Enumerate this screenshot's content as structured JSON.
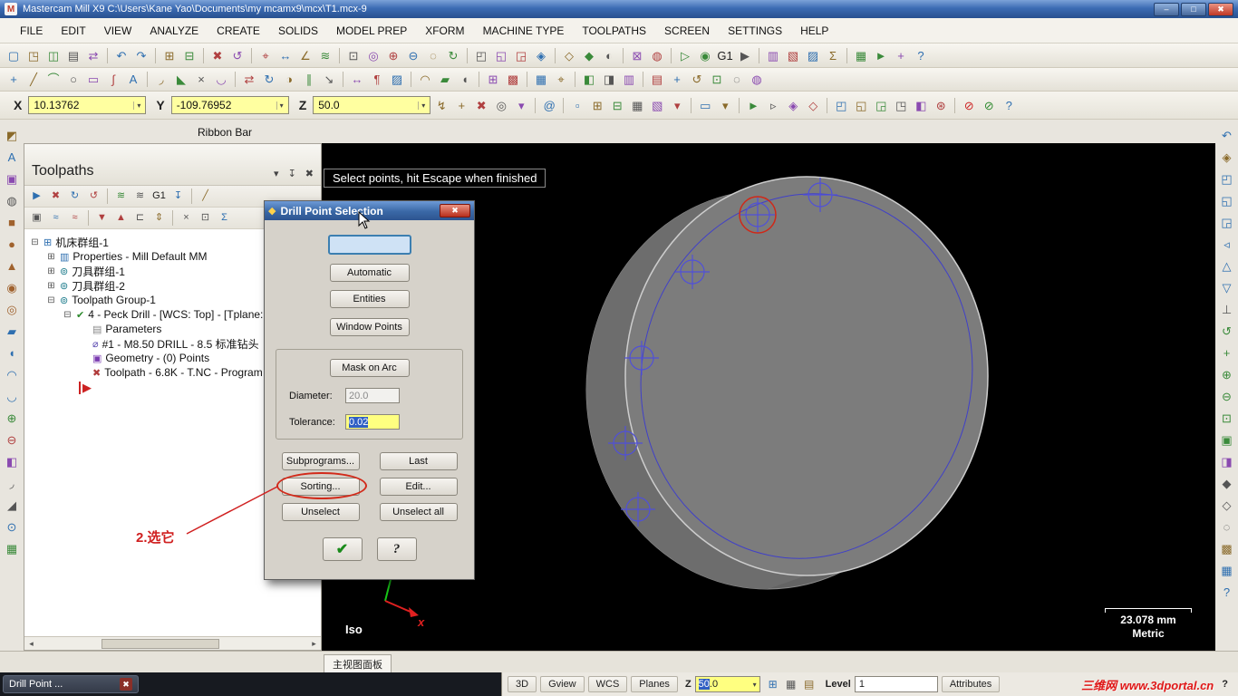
{
  "glyphs": {
    "dropdown": "▾",
    "scroll_left": "◂",
    "scroll_right": "▸"
  },
  "colors": {
    "field_yellow": "#ffff80",
    "selection_blue": "#2f5fc4",
    "annotation_red": "#d02020",
    "drill_blue": "#4848d0",
    "viewport_bg": "#000000"
  },
  "titlebar": {
    "app_icon": "M",
    "title": "Mastercam Mill X9  C:\\Users\\Kane Yao\\Documents\\my mcamx9\\mcx\\T1.mcx-9",
    "minimize": "–",
    "maximize": "□",
    "close": "✖"
  },
  "menu": {
    "items": [
      {
        "n": "menu-file",
        "label": "FILE"
      },
      {
        "n": "menu-edit",
        "label": "EDIT"
      },
      {
        "n": "menu-view",
        "label": "VIEW"
      },
      {
        "n": "menu-analyze",
        "label": "ANALYZE"
      },
      {
        "n": "menu-create",
        "label": "CREATE"
      },
      {
        "n": "menu-solids",
        "label": "SOLIDS"
      },
      {
        "n": "menu-model-prep",
        "label": "MODEL PREP"
      },
      {
        "n": "menu-xform",
        "label": "XFORM"
      },
      {
        "n": "menu-machine-type",
        "label": "MACHINE TYPE"
      },
      {
        "n": "menu-toolpaths",
        "label": "TOOLPATHS"
      },
      {
        "n": "menu-screen",
        "label": "SCREEN"
      },
      {
        "n": "menu-settings",
        "label": "SETTINGS"
      },
      {
        "n": "menu-help",
        "label": "HELP"
      }
    ]
  },
  "toolbars": {
    "row1": [
      {
        "n": "new-file-icon",
        "g": "▢"
      },
      {
        "n": "open-file-icon",
        "g": "◳"
      },
      {
        "n": "save-file-icon",
        "g": "◫"
      },
      {
        "n": "print-icon",
        "g": "▤"
      },
      {
        "n": "file-converters-icon",
        "g": "⇄"
      },
      "|",
      {
        "n": "undo-icon",
        "g": "↶",
        "c": "#2e6fb0"
      },
      {
        "n": "redo-icon",
        "g": "↷",
        "c": "#2e6fb0"
      },
      "|",
      {
        "n": "copy-screen-image-icon",
        "g": "⊞"
      },
      {
        "n": "paste-image-icon",
        "g": "⊟"
      },
      "|",
      {
        "n": "delete-entities-icon",
        "g": "✖",
        "c": "#b04040"
      },
      {
        "n": "undelete-icon",
        "g": "↺"
      },
      "|",
      {
        "n": "analyze-position-icon",
        "g": "⌖"
      },
      {
        "n": "analyze-distance-icon",
        "g": "↔"
      },
      {
        "n": "analyze-angle-icon",
        "g": "∠"
      },
      {
        "n": "analyze-dynamic-icon",
        "g": "≋"
      },
      "|",
      {
        "n": "zoom-window-icon",
        "g": "⊡"
      },
      {
        "n": "zoom-target-icon",
        "g": "◎"
      },
      {
        "n": "zoom-in-icon",
        "g": "⊕"
      },
      {
        "n": "zoom-out-icon",
        "g": "⊖"
      },
      {
        "n": "unzoom-icon",
        "g": "◌"
      },
      {
        "n": "repaint-icon",
        "g": "↻"
      },
      "|",
      {
        "n": "gview-top-icon",
        "g": "◰"
      },
      {
        "n": "gview-front-icon",
        "g": "◱"
      },
      {
        "n": "gview-right-icon",
        "g": "◲"
      },
      {
        "n": "gview-iso-icon",
        "g": "◈"
      },
      "|",
      {
        "n": "wireframe-display-icon",
        "g": "◇"
      },
      {
        "n": "shaded-display-icon",
        "g": "◆"
      },
      {
        "n": "translucent-display-icon",
        "g": "◐"
      },
      "|",
      {
        "n": "delete-duplicates-icon",
        "g": "⊠"
      },
      {
        "n": "blank-entity-icon",
        "g": "◍"
      },
      "|",
      {
        "n": "backplot-icon",
        "g": "▷",
        "c": "#3a8a3a"
      },
      {
        "n": "verify-icon",
        "g": "◉",
        "c": "#3a8a3a"
      },
      {
        "n": "post-process-icon",
        "g": "G1",
        "c": "#222"
      },
      {
        "n": "machine-sim-icon",
        "g": "▶"
      },
      "|",
      {
        "n": "toolpath-manager-toggle-icon",
        "g": "▥"
      },
      {
        "n": "solids-manager-toggle-icon",
        "g": "▧"
      },
      {
        "n": "art-manager-icon",
        "g": "▨"
      },
      {
        "n": "multithread-manager-icon",
        "g": "Σ"
      },
      "|",
      {
        "n": "grid-settings-icon",
        "g": "▦"
      },
      {
        "n": "run-user-app-icon",
        "g": "►",
        "c": "#3a8a3a"
      },
      {
        "n": "configure-icon",
        "g": "+"
      },
      {
        "n": "help-context-icon",
        "g": "?",
        "c": "#2e6fb0"
      }
    ],
    "row2": [
      {
        "n": "create-point-icon",
        "g": "+"
      },
      {
        "n": "create-line-icon",
        "g": "╱"
      },
      {
        "n": "create-arc-icon",
        "g": "⌒"
      },
      {
        "n": "create-circle-icon",
        "g": "○"
      },
      {
        "n": "create-rectangle-icon",
        "g": "▭"
      },
      {
        "n": "create-spline-icon",
        "g": "∫"
      },
      {
        "n": "create-letters-icon",
        "g": "A"
      },
      "|",
      {
        "n": "fillet-entities-icon",
        "g": "◞"
      },
      {
        "n": "chamfer-entities-icon",
        "g": "◣"
      },
      {
        "n": "trim-break-icon",
        "g": "×"
      },
      {
        "n": "join-entities-icon",
        "g": "◡"
      },
      "|",
      {
        "n": "xform-translate-icon",
        "g": "⇄"
      },
      {
        "n": "xform-rotate-icon",
        "g": "↻"
      },
      {
        "n": "xform-mirror-icon",
        "g": "◑"
      },
      {
        "n": "xform-offset-icon",
        "g": "∥"
      },
      {
        "n": "xform-scale-icon",
        "g": "↘"
      },
      "|",
      {
        "n": "drafting-dimension-icon",
        "g": "↔"
      },
      {
        "n": "drafting-note-icon",
        "g": "¶"
      },
      {
        "n": "crosshatch-icon",
        "g": "▨"
      },
      "|",
      {
        "n": "surface-net-icon",
        "g": "◠"
      },
      {
        "n": "solid-extrude-icon",
        "g": "▰"
      },
      {
        "n": "solid-revolve-icon",
        "g": "◖"
      },
      "|",
      {
        "n": "machine-group-properties-icon",
        "g": "⊞"
      },
      {
        "n": "material-setup-icon",
        "g": "▩"
      },
      "|",
      {
        "n": "grid-toggle-icon",
        "g": "▦"
      },
      {
        "n": "snap-settings-icon",
        "g": "⌖"
      },
      "|",
      {
        "n": "view-manager-icon",
        "g": "◧"
      },
      {
        "n": "plane-manager-icon",
        "g": "◨"
      },
      {
        "n": "level-manager-icon",
        "g": "▥"
      },
      "|",
      {
        "n": "group-manager-icon",
        "g": "▤"
      },
      {
        "n": "pan-icon",
        "g": "+"
      },
      {
        "n": "dynamic-rotate-icon",
        "g": "↺"
      },
      {
        "n": "zoom-fit-icon",
        "g": "⊡"
      },
      {
        "n": "hide-entities-icon",
        "g": "◌"
      },
      {
        "n": "isolate-icon",
        "g": "◍"
      }
    ]
  },
  "coord_bar": {
    "x_label": "X",
    "x_value": "10.13762",
    "y_label": "Y",
    "y_value": "-109.76952",
    "z_label": "Z",
    "z_value": "50.0",
    "icons": [
      {
        "n": "autocursor-override-icon",
        "g": "↯",
        "c": "#8a6a2a"
      },
      {
        "n": "autocursor-config-icon",
        "g": "+"
      },
      {
        "n": "clear-coord-icon",
        "g": "✖",
        "c": "#b04040"
      },
      {
        "n": "fastpoint-mode-icon",
        "g": "◎"
      },
      {
        "n": "autocursor-dropdown-icon",
        "g": "▾"
      },
      "|",
      {
        "n": "coord-help-icon",
        "g": "@",
        "c": "#2e6fb0"
      },
      "|",
      {
        "n": "select-window-icon",
        "g": "▫"
      },
      {
        "n": "select-polygon-icon",
        "g": "⊞"
      },
      {
        "n": "select-single-icon",
        "g": "⊟"
      },
      {
        "n": "select-area-icon",
        "g": "▦"
      },
      {
        "n": "select-vector-icon",
        "g": "▧"
      },
      {
        "n": "selection-dropdown-icon",
        "g": "▾"
      },
      "|",
      {
        "n": "select-all-icon",
        "g": "▭"
      },
      {
        "n": "select-only-dropdown-icon",
        "g": "▾"
      },
      "|",
      {
        "n": "select-last-icon",
        "g": "►"
      },
      {
        "n": "select-result-icon",
        "g": "▹"
      },
      {
        "n": "select-solids-mode-icon",
        "g": "◈"
      },
      {
        "n": "select-wireframe-mode-icon",
        "g": "◇"
      },
      "|",
      {
        "n": "gview-wcs-icon",
        "g": "◰"
      },
      {
        "n": "gview-cplane-icon",
        "g": "◱"
      },
      {
        "n": "gview-tplane-icon",
        "g": "◲"
      },
      {
        "n": "gview-iso-small-icon",
        "g": "◳"
      },
      {
        "n": "wcs-indicator-icon",
        "g": "◧"
      },
      {
        "n": "plane-follow-icon",
        "g": "⊛"
      },
      "|",
      {
        "n": "gview-lock-icon",
        "g": "⊘",
        "c": "#cc2222"
      },
      {
        "n": "plane-lock-icon",
        "g": "⊘",
        "c": "#2e8a2e"
      },
      {
        "n": "autocursor-help-icon",
        "g": "?",
        "c": "#2e6fb0"
      }
    ]
  },
  "ribbon_bar_label": "Ribbon Bar",
  "left_toolbar": [
    {
      "n": "raster-to-vector-icon",
      "g": "◩",
      "c": "#8a6a2a"
    },
    {
      "n": "create-letters-left-icon",
      "g": "A",
      "c": "#2e6fb0"
    },
    {
      "n": "bounding-box-icon",
      "g": "▣",
      "c": "#8a4ab0"
    },
    {
      "n": "silhouette-boundary-icon",
      "g": "◍",
      "c": "#555"
    },
    {
      "n": "solid-box-icon",
      "g": "■",
      "c": "#a0622e"
    },
    {
      "n": "solid-cylinder-icon",
      "g": "●",
      "c": "#a0622e"
    },
    {
      "n": "solid-cone-icon",
      "g": "▲",
      "c": "#a0622e"
    },
    {
      "n": "solid-sphere-icon",
      "g": "◉",
      "c": "#a0622e"
    },
    {
      "n": "solid-torus-icon",
      "g": "◎",
      "c": "#a0622e"
    },
    {
      "n": "solid-extrude-left-icon",
      "g": "▰",
      "c": "#2e6fb0"
    },
    {
      "n": "solid-revolve-left-icon",
      "g": "◖",
      "c": "#2e6fb0"
    },
    {
      "n": "solid-sweep-icon",
      "g": "◠",
      "c": "#2e6fb0"
    },
    {
      "n": "solid-loft-icon",
      "g": "◡",
      "c": "#2e6fb0"
    },
    {
      "n": "boolean-add-icon",
      "g": "⊕",
      "c": "#3a8a3a"
    },
    {
      "n": "boolean-remove-icon",
      "g": "⊖",
      "c": "#b04040"
    },
    {
      "n": "solid-shell-icon",
      "g": "◧",
      "c": "#8a4ab0"
    },
    {
      "n": "solid-fillet-icon",
      "g": "◞",
      "c": "#555"
    },
    {
      "n": "solid-chamfer-icon",
      "g": "◢",
      "c": "#555"
    },
    {
      "n": "solid-hole-icon",
      "g": "⊙",
      "c": "#2e6fb0"
    },
    {
      "n": "solid-pattern-icon",
      "g": "▦",
      "c": "#3a8a3a"
    }
  ],
  "right_toolbar": [
    {
      "n": "view-previous-icon",
      "g": "↶",
      "c": "#2e6fb0"
    },
    {
      "n": "view-iso-icon",
      "g": "◈",
      "c": "#8a6a2a"
    },
    {
      "n": "view-top-icon",
      "g": "◰",
      "c": "#2e6fb0"
    },
    {
      "n": "view-front-icon",
      "g": "◱",
      "c": "#2e6fb0"
    },
    {
      "n": "view-right-icon",
      "g": "◲",
      "c": "#2e6fb0"
    },
    {
      "n": "view-left-icon",
      "g": "◃",
      "c": "#2e6fb0"
    },
    {
      "n": "view-back-icon",
      "g": "△",
      "c": "#2e6fb0"
    },
    {
      "n": "view-bottom-icon",
      "g": "▽",
      "c": "#2e6fb0"
    },
    {
      "n": "view-normal-icon",
      "g": "⊥",
      "c": "#555"
    },
    {
      "n": "rotate-view-icon",
      "g": "↺",
      "c": "#3a8a3a"
    },
    {
      "n": "pan-view-icon",
      "g": "+",
      "c": "#3a8a3a"
    },
    {
      "n": "zoom-in-right-icon",
      "g": "⊕",
      "c": "#3a8a3a"
    },
    {
      "n": "zoom-out-right-icon",
      "g": "⊖",
      "c": "#3a8a3a"
    },
    {
      "n": "zoom-window-right-icon",
      "g": "⊡",
      "c": "#3a8a3a"
    },
    {
      "n": "fit-view-icon",
      "g": "▣",
      "c": "#3a8a3a"
    },
    {
      "n": "section-view-icon",
      "g": "◨",
      "c": "#8a4ab0"
    },
    {
      "n": "shade-toggle-icon",
      "g": "◆",
      "c": "#555"
    },
    {
      "n": "wireframe-toggle-icon",
      "g": "◇",
      "c": "#555"
    },
    {
      "n": "blank-toggle-icon",
      "g": "◌",
      "c": "#555"
    },
    {
      "n": "material-render-icon",
      "g": "▩",
      "c": "#8a6a2a"
    },
    {
      "n": "viewport-settings-icon",
      "g": "▦",
      "c": "#2e6fb0"
    },
    {
      "n": "viewsheet-help-icon",
      "g": "?",
      "c": "#2e6fb0"
    }
  ],
  "toolpaths_panel": {
    "title": "Toolpaths",
    "dropdown_glyph": "▾",
    "pin_glyph": "↧",
    "close_glyph": "✖",
    "toolbar_row1": [
      {
        "n": "tp-select-all-icon",
        "g": "▶",
        "c": "#2e6fb0"
      },
      {
        "n": "tp-select-none-icon",
        "g": "✖",
        "c": "#b04040"
      },
      {
        "n": "tp-regen-all-icon",
        "g": "↻",
        "c": "#2e6fb0"
      },
      {
        "n": "tp-regen-selected-icon",
        "g": "↺",
        "c": "#b04040"
      },
      "|",
      {
        "n": "tp-filter-a-icon",
        "g": "≋",
        "c": "#3a8a3a"
      },
      {
        "n": "tp-filter-b-icon",
        "g": "≋",
        "c": "#555"
      },
      {
        "n": "tp-g1-icon",
        "g": "G1",
        "c": "#222"
      },
      {
        "n": "tp-send-icon",
        "g": "↧",
        "c": "#2e6fb0"
      },
      "|",
      {
        "n": "tp-simulate-icon",
        "g": "╱",
        "c": "#8a6a2a"
      }
    ],
    "toolbar_row2": [
      {
        "n": "tp-lock-icon",
        "g": "▣",
        "c": "#555"
      },
      {
        "n": "tp-toggle-display-icon",
        "g": "≈",
        "c": "#2e6fb0"
      },
      {
        "n": "tp-toggle-rapid-icon",
        "g": "≈",
        "c": "#b04040"
      },
      "|",
      {
        "n": "tp-move-down-icon",
        "g": "▼",
        "c": "#b04040"
      },
      {
        "n": "tp-move-up-icon",
        "g": "▲",
        "c": "#b04040"
      },
      {
        "n": "tp-insert-icon",
        "g": "⊏",
        "c": "#555"
      },
      {
        "n": "tp-scroll-icon",
        "g": "⇕",
        "c": "#8a6a2a"
      },
      "|",
      {
        "n": "tp-cut-icon",
        "g": "×",
        "c": "#555"
      },
      {
        "n": "tp-copy-icon",
        "g": "⊡",
        "c": "#555"
      },
      {
        "n": "tp-stats-icon",
        "g": "Σ",
        "c": "#2e6fb0"
      }
    ],
    "tree": [
      {
        "cls": "i0",
        "e": "⊟",
        "g": "⊞",
        "c": "#2e6fb0",
        "n": "tree-machine-group",
        "label": "机床群组-1"
      },
      {
        "cls": "i1",
        "e": "⊞",
        "g": "▥",
        "c": "#2e6fb0",
        "n": "tree-properties",
        "label": "Properties - Mill Default MM"
      },
      {
        "cls": "i1",
        "e": "⊞",
        "g": "⊚",
        "c": "#1a7a8a",
        "n": "tree-tool-group-1",
        "label": "刀具群组-1"
      },
      {
        "cls": "i1",
        "e": "⊞",
        "g": "⊚",
        "c": "#1a7a8a",
        "n": "tree-tool-group-2",
        "label": "刀具群组-2"
      },
      {
        "cls": "i1",
        "e": "⊟",
        "g": "⊚",
        "c": "#1a7a8a",
        "n": "tree-toolpath-group",
        "label": "Toolpath Group-1"
      },
      {
        "cls": "i2",
        "e": "⊟",
        "g": "✔",
        "c": "#2e8a2e",
        "n": "tree-operation-peck-drill",
        "label": "4 - Peck Drill - [WCS: Top] - [Tplane:"
      },
      {
        "cls": "i3",
        "e": "",
        "g": "▤",
        "c": "#888",
        "n": "tree-parameters",
        "label": "Parameters"
      },
      {
        "cls": "i3",
        "e": "",
        "g": "⌀",
        "c": "#5a4ab0",
        "n": "tree-tool",
        "label": "#1 - M8.50 DRILL - 8.5 标准钻头"
      },
      {
        "cls": "i3",
        "e": "",
        "g": "▣",
        "c": "#7a3ab0",
        "n": "tree-geometry",
        "label": "Geometry - (0) Points"
      },
      {
        "cls": "i3",
        "e": "",
        "g": "✖",
        "c": "#b03a3a",
        "n": "tree-toolpath-file",
        "label": "Toolpath - 6.8K - T.NC - Program"
      }
    ],
    "insert_arrow_glyph": "▶"
  },
  "viewport": {
    "prompt": "Select points, hit Escape when finished",
    "view_label": "Iso",
    "scale_value": "23.078 mm",
    "scale_units": "Metric",
    "axis_x_label": "x"
  },
  "dialog": {
    "title": "Drill Point Selection",
    "icon_glyph": "◆",
    "close_glyph": "✖",
    "focus_button_label": "",
    "automatic": "Automatic",
    "entities": "Entities",
    "window_points": "Window Points",
    "mask_on_arc": "Mask on Arc",
    "diameter_label": "Diameter:",
    "diameter_value": "20.0",
    "tolerance_label": "Tolerance:",
    "tolerance_value": "0.02",
    "subprograms": "Subprograms...",
    "last": "Last",
    "sorting": "Sorting...",
    "edit": "Edit...",
    "unselect": "Unselect",
    "unselect_all": "Unselect all",
    "ok_glyph": "✔",
    "help_glyph": "?"
  },
  "annotation": {
    "text": "2.选它"
  },
  "bottom_tab": {
    "label": "主视图面板"
  },
  "status_bar": {
    "btn_3d": "3D",
    "gview": "Gview",
    "wcs": "WCS",
    "planes": "Planes",
    "z_label": "Z",
    "z_value_sel": "50",
    "z_value_rest": ".0",
    "icons": [
      {
        "n": "z-depth-icon",
        "g": "⊞",
        "c": "#2e6fb0"
      },
      {
        "n": "screen-blank-icon",
        "g": "▦",
        "c": "#555"
      },
      {
        "n": "viewsheet-icon",
        "g": "▤",
        "c": "#8a6a2a"
      }
    ],
    "level_label": "Level",
    "level_value": "1",
    "attributes": "Attributes",
    "help": "?"
  },
  "taskbar": {
    "chip_label": "Drill Point ...",
    "chip_close": "✖"
  },
  "watermark": "三维网 www.3dportal.cn"
}
